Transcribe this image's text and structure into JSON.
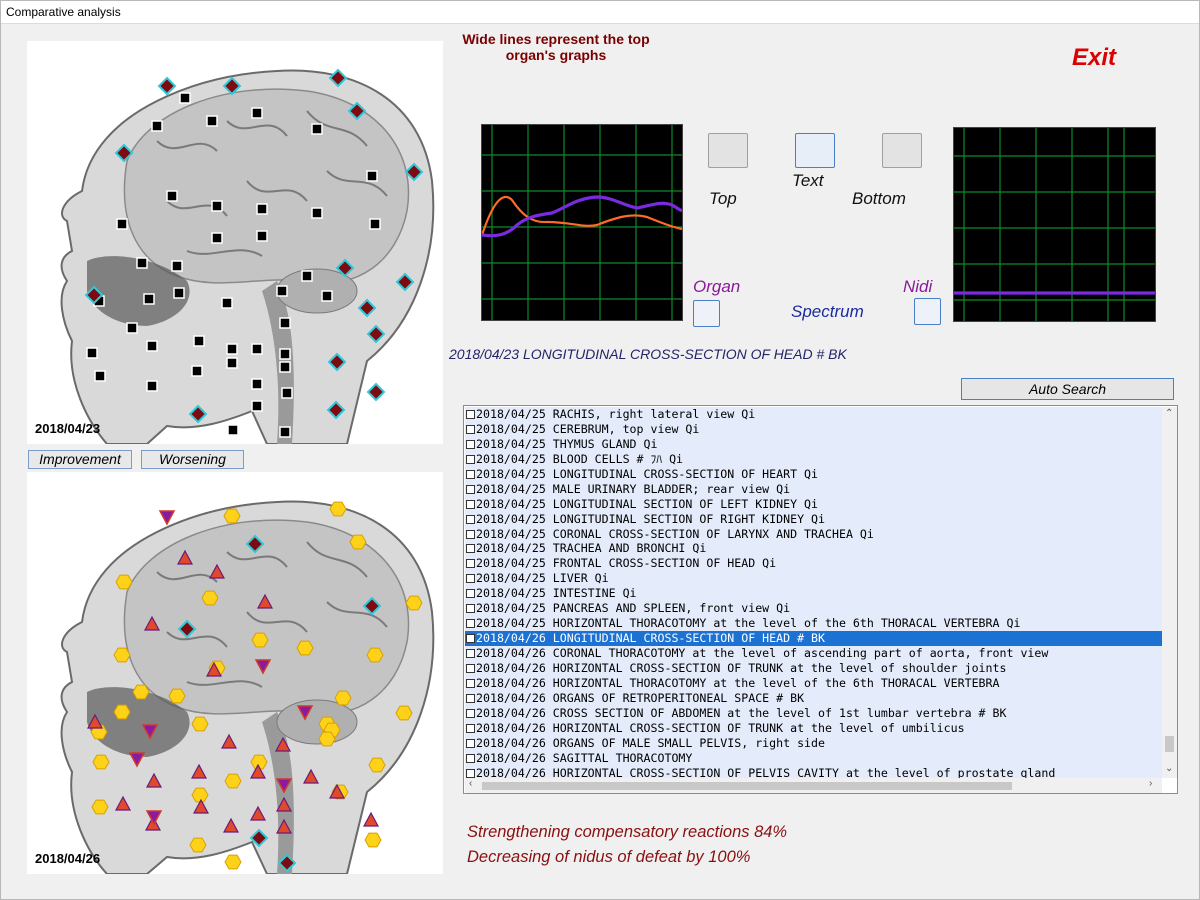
{
  "window": {
    "title": "Comparative analysis"
  },
  "left_panel": {
    "top_date": "2018/04/23",
    "bottom_date": "2018/04/26",
    "improvement_label": "Improvement",
    "worsening_label": "Worsening"
  },
  "header": {
    "note": "Wide lines represent the top organ's graphs",
    "exit_label": "Exit"
  },
  "graph_controls": {
    "top_label": "Top",
    "text_label": "Text",
    "bottom_label": "Bottom",
    "organ_label": "Organ",
    "spectrum_label": "Spectrum",
    "nidi_label": "Nidi"
  },
  "caption": "2018/04/23 LONGITUDINAL CROSS-SECTION OF HEAD # BK",
  "auto_search_label": "Auto Search",
  "list": {
    "selected_index": 15,
    "items": [
      "2018/04/25  RACHIS, right lateral view  Qi",
      "2018/04/25  CEREBRUM, top view  Qi",
      "2018/04/25  THYMUS  GLAND  Qi",
      "2018/04/25  BLOOD  CELLS  # ﾌﾊ  Qi",
      "2018/04/25  LONGITUDINAL CROSS-SECTION OF HEART  Qi",
      "2018/04/25  MALE URINARY BLADDER; rear view  Qi",
      "2018/04/25  LONGITUDINAL  SECTION  OF  LEFT KIDNEY  Qi",
      "2018/04/25  LONGITUDINAL  SECTION  OF  RIGHT  KIDNEY  Qi",
      "2018/04/25  CORONAL CROSS-SECTION OF LARYNX AND TRACHEA  Qi",
      "2018/04/25  TRACHEA AND BRONCHI  Qi",
      "2018/04/25  FRONTAL CROSS-SECTION OF HEAD  Qi",
      "2018/04/25  LIVER  Qi",
      "2018/04/25  INTESTINE  Qi",
      "2018/04/25  PANCREAS  AND  SPLEEN,  front  view  Qi",
      "2018/04/25  HORIZONTAL THORACOTOMY at the level of the 6th THORACAL VERTEBRA  Qi",
      "2018/04/26  LONGITUDINAL CROSS-SECTION OF HEAD # BK",
      "2018/04/26  CORONAL THORACOTOMY at the level of ascending part of aorta, front view",
      "2018/04/26  HORIZONTAL CROSS-SECTION OF TRUNK at the level of shoulder joints",
      "2018/04/26  HORIZONTAL THORACOTOMY at the level of the 6th THORACAL VERTEBRA",
      "2018/04/26  ORGANS OF RETROPERITONEAL SPACE # BK",
      "2018/04/26  CROSS SECTION OF ABDOMEN at the level of 1st lumbar vertebra # BK",
      "2018/04/26  HORIZONTAL CROSS-SECTION OF TRUNK at the level of umbilicus",
      "2018/04/26  ORGANS OF MALE SMALL PELVIS, right side",
      "2018/04/26  SAGITTAL THORACOTOMY",
      "2018/04/26  HORIZONTAL CROSS-SECTION OF PELVIS CAVITY at the level of prostate gland"
    ]
  },
  "results": {
    "line1": "Strengthening compensatory reactions 84%",
    "line2": "Decreasing of nidus of defeat by 100%"
  },
  "colors": {
    "orange_line": "#ff6a2a",
    "purple_line": "#7a2ae0",
    "grid": "#0f8a2a",
    "exit": "#dd0000",
    "result_text": "#8a1010"
  }
}
